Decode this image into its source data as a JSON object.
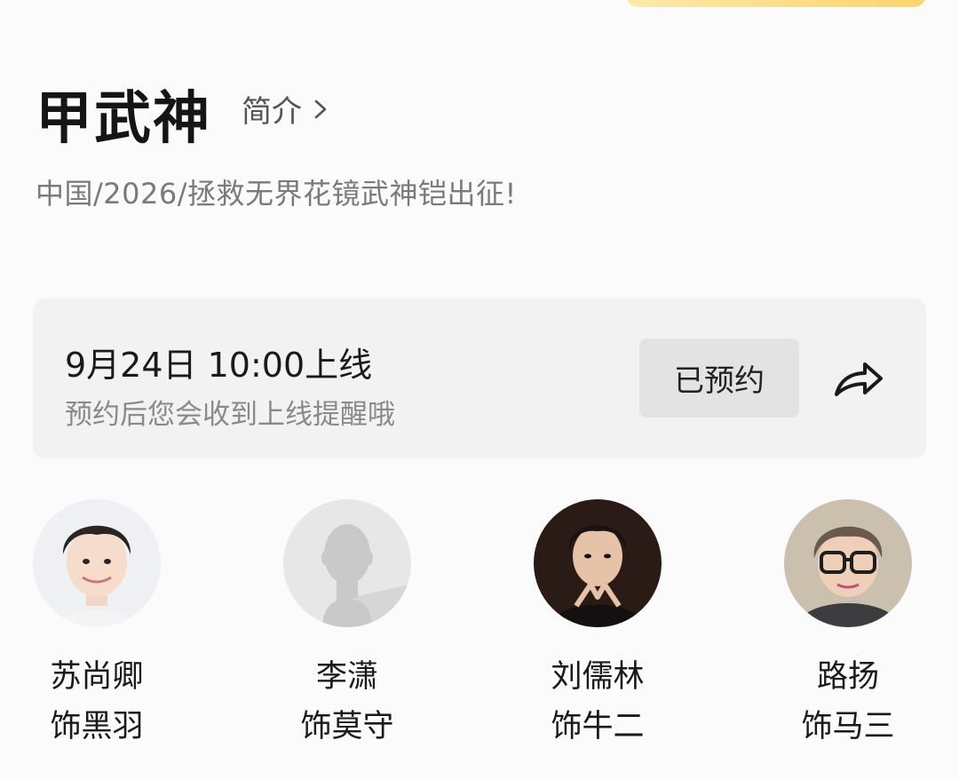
{
  "show": {
    "title": "甲武神",
    "intro_label": "简介",
    "subtitle": "中国/2026/拯救无界花镜武神铠出征!"
  },
  "release": {
    "date_text": "9月24日 10:00上线",
    "note": "预约后您会收到上线提醒哦",
    "reserve_label": "已预约"
  },
  "cast": [
    {
      "name": "苏尚卿",
      "role": "饰黑羽"
    },
    {
      "name": "李潇",
      "role": "饰莫守"
    },
    {
      "name": "刘儒林",
      "role": "饰牛二"
    },
    {
      "name": "路扬",
      "role": "饰马三"
    }
  ],
  "colors": {
    "accent": "#fcd56b",
    "card_bg": "#f2f2f2",
    "button_bg": "#e3e3e3"
  },
  "icons": {
    "intro": "chevron-right-icon",
    "share": "share-arrow-icon"
  }
}
